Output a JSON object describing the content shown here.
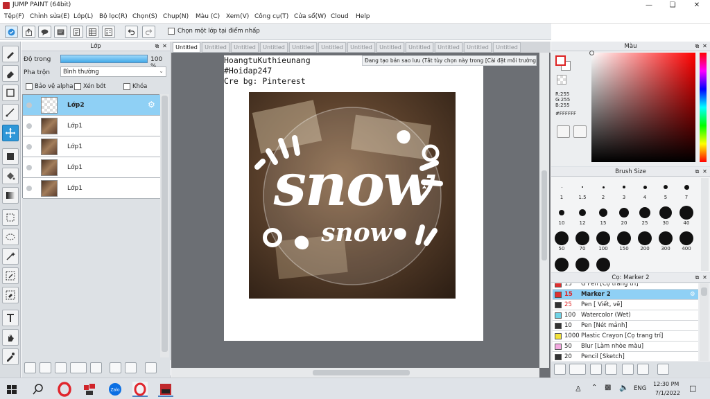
{
  "window": {
    "title": "JUMP PAINT (64bit)"
  },
  "menu": [
    "Tệp(F)",
    "Chỉnh sửa(E)",
    "Lớp(L)",
    "Bộ lọc(R)",
    "Chọn(S)",
    "Chụp(N)",
    "Màu (C)",
    "Xem(V)",
    "Công cụ(T)",
    "Cửa sổ(W)",
    "Cloud",
    "Help"
  ],
  "toolbar": {
    "pick_layer_label": "Chọn một lớp tại điểm nhấp"
  },
  "layer_panel": {
    "title": "Lớp",
    "opacity_label": "Độ trong",
    "opacity_value": "100 %",
    "blend_label": "Pha trộn",
    "blend_value": "Bình thường",
    "protect_alpha": "Bảo vệ alpha",
    "clip": "Xén bớt",
    "lock": "Khóa",
    "layers": [
      "Lớp2",
      "Lớp1",
      "Lớp1",
      "Lớp1",
      "Lớp1"
    ]
  },
  "tabs": [
    "Untitled",
    "Untitled",
    "Untitled",
    "Untitled",
    "Untitled",
    "Untitled",
    "Untitled",
    "Untitled",
    "Untitled",
    "Untitled",
    "Untitled",
    "Untitled"
  ],
  "canvas": {
    "lines": [
      "HoangtuKuthieunang",
      "#Hoidap247",
      "Cre bg: Pinterest"
    ],
    "notice": "Đang tạo bản sao lưu (Tắt tùy chọn này trong [Cài đặt môi trường])",
    "art_main": "snow",
    "art_sub": "snow"
  },
  "color_panel": {
    "title": "Màu",
    "r": "R:255",
    "g": "G:255",
    "b": "B:255",
    "hex": "#FFFFFF"
  },
  "brush_panel": {
    "title": "Brush Size",
    "sizes": [
      "1",
      "1.5",
      "2",
      "3",
      "4",
      "5",
      "7",
      "10",
      "12",
      "15",
      "20",
      "25",
      "30",
      "40",
      "50",
      "70",
      "100",
      "150",
      "200",
      "300",
      "400"
    ]
  },
  "toolset_panel": {
    "title": "Cọ: Marker 2",
    "items": [
      {
        "size": "15",
        "name": "G Pen [Cọ trang trí]",
        "color": "#e03030"
      },
      {
        "size": "15",
        "name": "Marker 2",
        "color": "#e03030"
      },
      {
        "size": "25",
        "name": "Pen [ Viết, vẽ]",
        "color": "#333333"
      },
      {
        "size": "100",
        "name": "Watercolor (Wet)",
        "color": "#6fd3e6"
      },
      {
        "size": "10",
        "name": "Pen [Nét mảnh]",
        "color": "#333333"
      },
      {
        "size": "1000",
        "name": "Plastic Crayon [Cọ trang trí]",
        "color": "#f3e23a"
      },
      {
        "size": "50",
        "name": "Blur [Làm nhòe màu]",
        "color": "#f3a9e0"
      },
      {
        "size": "20",
        "name": "Pencil [Sketch]",
        "color": "#333333"
      }
    ]
  },
  "taskbar": {
    "time": "12:30 PM",
    "date": "7/1/2022",
    "lang": "ENG"
  }
}
